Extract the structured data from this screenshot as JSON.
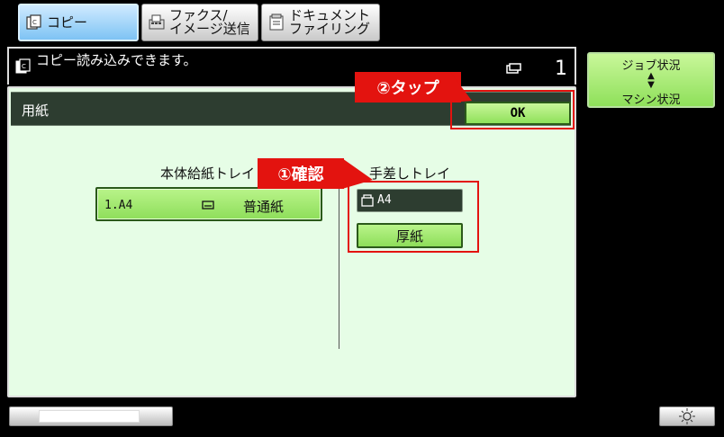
{
  "tabs": [
    {
      "label": "コピー",
      "active": true
    },
    {
      "label_line1": "ファクス/",
      "label_line2": "イメージ送信"
    },
    {
      "label_line1": "ドキュメント",
      "label_line2": "ファイリング"
    }
  ],
  "message": {
    "text": "コピー読み込みできます。",
    "copies": "1"
  },
  "panel": {
    "title": "用紙",
    "ok_label": "OK",
    "main_tray": {
      "label": "本体給紙トレイ",
      "tray_id": "1.A4",
      "paper_type": "普通紙"
    },
    "bypass_tray": {
      "label": "手差しトレイ",
      "size": "A4",
      "paper_type": "厚紙"
    }
  },
  "annotations": {
    "tap": "②タップ",
    "confirm": "①確認",
    "color": "#e3130f"
  },
  "sidebar": {
    "job_status": "ジョブ状況",
    "machine_status": "マシン状況"
  },
  "icons": [
    "copy-icon",
    "fax-icon",
    "document-filing-icon",
    "copies-icon",
    "paper-tray-icon",
    "bypass-tray-icon",
    "up-down-arrows-icon",
    "brightness-icon"
  ]
}
